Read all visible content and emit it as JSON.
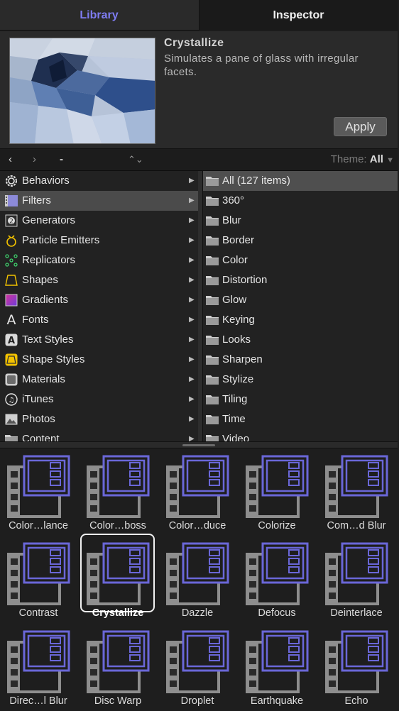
{
  "tabs": {
    "library": "Library",
    "inspector": "Inspector"
  },
  "preview": {
    "title": "Crystallize",
    "description": "Simulates a pane of glass with irregular facets.",
    "apply_label": "Apply"
  },
  "navbar": {
    "back": "‹",
    "forward": "›",
    "path": "-",
    "updown": "⌃⌄",
    "theme_label": "Theme:",
    "theme_value": "All"
  },
  "left_list": [
    {
      "label": "Behaviors",
      "icon": "gear-icon"
    },
    {
      "label": "Filters",
      "icon": "film-icon"
    },
    {
      "label": "Generators",
      "icon": "generator-icon"
    },
    {
      "label": "Particle Emitters",
      "icon": "particle-icon"
    },
    {
      "label": "Replicators",
      "icon": "replicator-icon"
    },
    {
      "label": "Shapes",
      "icon": "shape-icon"
    },
    {
      "label": "Gradients",
      "icon": "gradient-icon"
    },
    {
      "label": "Fonts",
      "icon": "font-icon"
    },
    {
      "label": "Text Styles",
      "icon": "text-style-icon"
    },
    {
      "label": "Shape Styles",
      "icon": "shape-style-icon"
    },
    {
      "label": "Materials",
      "icon": "material-icon"
    },
    {
      "label": "iTunes",
      "icon": "music-icon"
    },
    {
      "label": "Photos",
      "icon": "photo-icon"
    },
    {
      "label": "Content",
      "icon": "folder-icon"
    }
  ],
  "right_list": [
    "All (127 items)",
    "360°",
    "Blur",
    "Border",
    "Color",
    "Distortion",
    "Glow",
    "Keying",
    "Looks",
    "Sharpen",
    "Stylize",
    "Tiling",
    "Time",
    "Video"
  ],
  "grid_items": [
    "Color…lance",
    "Color…boss",
    "Color…duce",
    "Colorize",
    "Com…d Blur",
    "Contrast",
    "Crystallize",
    "Dazzle",
    "Defocus",
    "Deinterlace",
    "Direc…l Blur",
    "Disc Warp",
    "Droplet",
    "Earthquake",
    "Echo"
  ],
  "colors": {
    "accent": "#7e7cf2",
    "filter_icon": "#6a67d8",
    "selection": "#4b4b4b"
  }
}
